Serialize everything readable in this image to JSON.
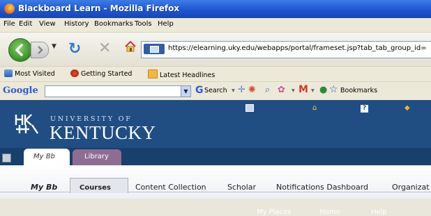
{
  "window": {
    "title": "Blackboard Learn - Mozilla Firefox"
  },
  "menu": [
    "File",
    "Edit",
    "View",
    "History",
    "Bookmarks",
    "Tools",
    "Help"
  ],
  "nav": {
    "url": "https://elearning.uky.edu/webapps/portal/frameset.jsp?tab_tab_group_id="
  },
  "bookmarks": [
    "Most Visited",
    "Getting Started",
    "Latest Headlines"
  ],
  "google": {
    "logo": "Google",
    "search_label": "Search",
    "bookmarks_label": "Bookmarks"
  },
  "university": {
    "top": "UNIVERSITY OF",
    "name": "KENTUCKY"
  },
  "toplinks": [
    "My Places",
    "Home",
    "Help"
  ],
  "tabs": [
    "My Bb",
    "Library"
  ],
  "subnav": [
    "My Bb",
    "Courses",
    "Content Collection",
    "Scholar",
    "Notifications Dashboard",
    "Organizat"
  ],
  "colors": {
    "page_bg": "#214e82",
    "library_tab": "#8f6d93"
  }
}
